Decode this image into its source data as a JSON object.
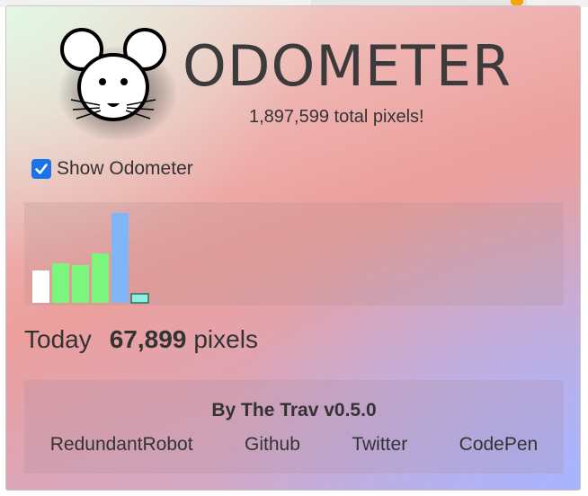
{
  "header": {
    "title": "ODOMETER",
    "total_pixels": "1,897,599 total pixels!"
  },
  "settings": {
    "show_odometer_label": "Show Odometer",
    "show_odometer_checked": true
  },
  "chart_data": {
    "type": "bar",
    "values": [
      36,
      44,
      42,
      55,
      100,
      10
    ],
    "colors": [
      "#ffffff",
      "#7cf57c",
      "#7cf57c",
      "#7cf57c",
      "#82b4f8",
      "#8ef0e0"
    ],
    "ylim": [
      0,
      100
    ]
  },
  "today": {
    "label": "Today",
    "value": "67,899",
    "unit": "pixels"
  },
  "footer": {
    "byline": "By The Trav v0.5.0",
    "links": [
      "RedundantRobot",
      "Github",
      "Twitter",
      "CodePen"
    ]
  },
  "colors": {
    "accent": "#1a73e8",
    "text": "#333333"
  }
}
